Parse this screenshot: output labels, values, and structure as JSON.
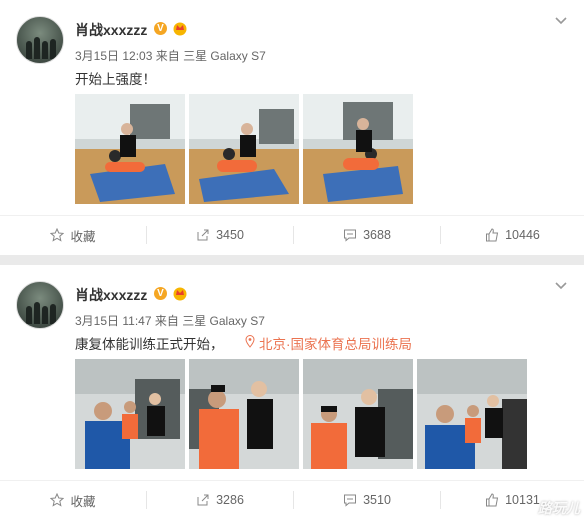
{
  "posts": [
    {
      "user": "肖战xxxzzz",
      "date": "3月15日 12:03",
      "source_prefix": "来自",
      "source_device": "三星 Galaxy S7",
      "text": "开始上强度！",
      "actions": {
        "favorite": "收藏",
        "repost": "3450",
        "comment": "3688",
        "like": "10446"
      }
    },
    {
      "user": "肖战xxxzzz",
      "date": "3月15日 11:47",
      "source_prefix": "来自",
      "source_device": "三星 Galaxy S7",
      "text": "康复体能训练正式开始，",
      "location": "北京·国家体育总局训练局",
      "actions": {
        "favorite": "收藏",
        "repost": "3286",
        "comment": "3510",
        "like": "10131"
      }
    }
  ],
  "colors": {
    "accent": "#eb7350",
    "vbadge": "#f5a623",
    "bg": "#eaeaea"
  },
  "watermark": "路玩儿"
}
